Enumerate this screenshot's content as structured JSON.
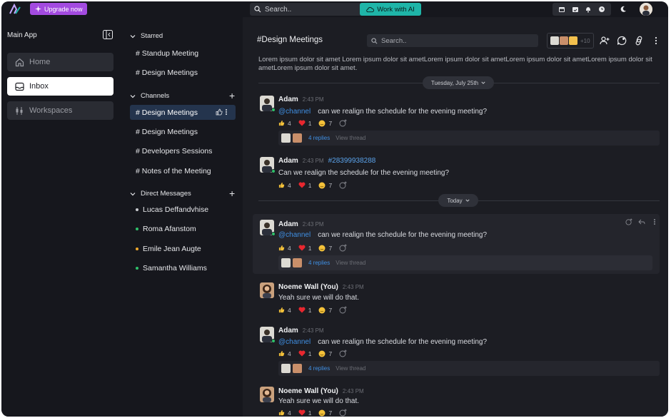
{
  "topbar": {
    "upgrade_label": "Upgrade now",
    "search_placeholder": "Search..",
    "work_ai_label": "Work with AI",
    "icons": [
      "calendar-icon",
      "calendar-check-icon",
      "bell-icon",
      "clock-icon",
      "moon-icon"
    ]
  },
  "sidebar": {
    "title": "Main App",
    "nav": [
      {
        "label": "Home",
        "icon": "home-icon"
      },
      {
        "label": "Inbox",
        "icon": "inbox-icon"
      },
      {
        "label": "Workspaces",
        "icon": "workspaces-icon"
      }
    ]
  },
  "channels_panel": {
    "starred_title": "Starred",
    "starred": [
      "# Standup Meeting",
      "# Design Meetings"
    ],
    "channels_title": "Channels",
    "channels": [
      "# Design Meetings",
      "# Design Meetings",
      "# Developers Sessions",
      "# Notes of the Meeting"
    ],
    "dm_title": "Direct Messages",
    "dms": [
      {
        "name": "Lucas Deffandvhise",
        "status_color": "#c9cbd0"
      },
      {
        "name": "Roma Afanstom",
        "status_color": "#2fc06a"
      },
      {
        "name": "Emile Jean Augte",
        "status_color": "#f0a92b"
      },
      {
        "name": "Samantha Williams",
        "status_color": "#2fc06a"
      }
    ]
  },
  "main": {
    "title": "#Design Meetings",
    "search_placeholder": "Search..",
    "member_more": "+10",
    "description": "Lorem ipsum dolor sit amet Lorem ipsum dolor sit ametLorem ipsum dolor sit ametLorem ipsum dolor sit ametLorem ipsum dolor sit ametLorem ipsum dolor sit amet.",
    "date_divider_1": "Tuesday, July 25th",
    "date_divider_2": "Today",
    "messages": [
      {
        "author": "Adam",
        "time": "2:43 PM",
        "mention": "@channel",
        "text": "can we realign the schedule for the evening meeting?",
        "reactions": [
          "4",
          "1",
          "7"
        ],
        "replies": "4 replies",
        "view": "View thread"
      },
      {
        "author": "Adam",
        "time": "2:43 PM",
        "tag": "#28399938288",
        "text": "Can we realign the schedule for the evening meeting?",
        "reactions": [
          "4",
          "1",
          "7"
        ]
      },
      {
        "author": "Adam",
        "time": "2:43 PM",
        "mention": "@channel",
        "text": "can we realign the schedule for the evening meeting?",
        "reactions": [
          "4",
          "1",
          "7"
        ],
        "replies": "4 replies",
        "view": "View thread"
      },
      {
        "author": "Noeme Wall (You)",
        "time": "2:43 PM",
        "text": "Yeah sure we will do that.",
        "reactions": [
          "4",
          "1",
          "7"
        ]
      },
      {
        "author": "Adam",
        "time": "2:43 PM",
        "mention": "@channel",
        "text": "can we realign the schedule for the evening meeting?",
        "reactions": [
          "4",
          "1",
          "7"
        ],
        "replies": "4 replies",
        "view": "View thread"
      },
      {
        "author": "Noeme Wall (You)",
        "time": "2:43 PM",
        "text": "Yeah sure we will do that.",
        "reactions": [
          "4",
          "1",
          "7"
        ]
      }
    ]
  },
  "colors": {
    "accent_purple": "#a34be0",
    "accent_teal": "#1fb5a8",
    "link_blue": "#3f8fe3",
    "bg": "#16171d",
    "main_bg": "#1c1d23"
  }
}
